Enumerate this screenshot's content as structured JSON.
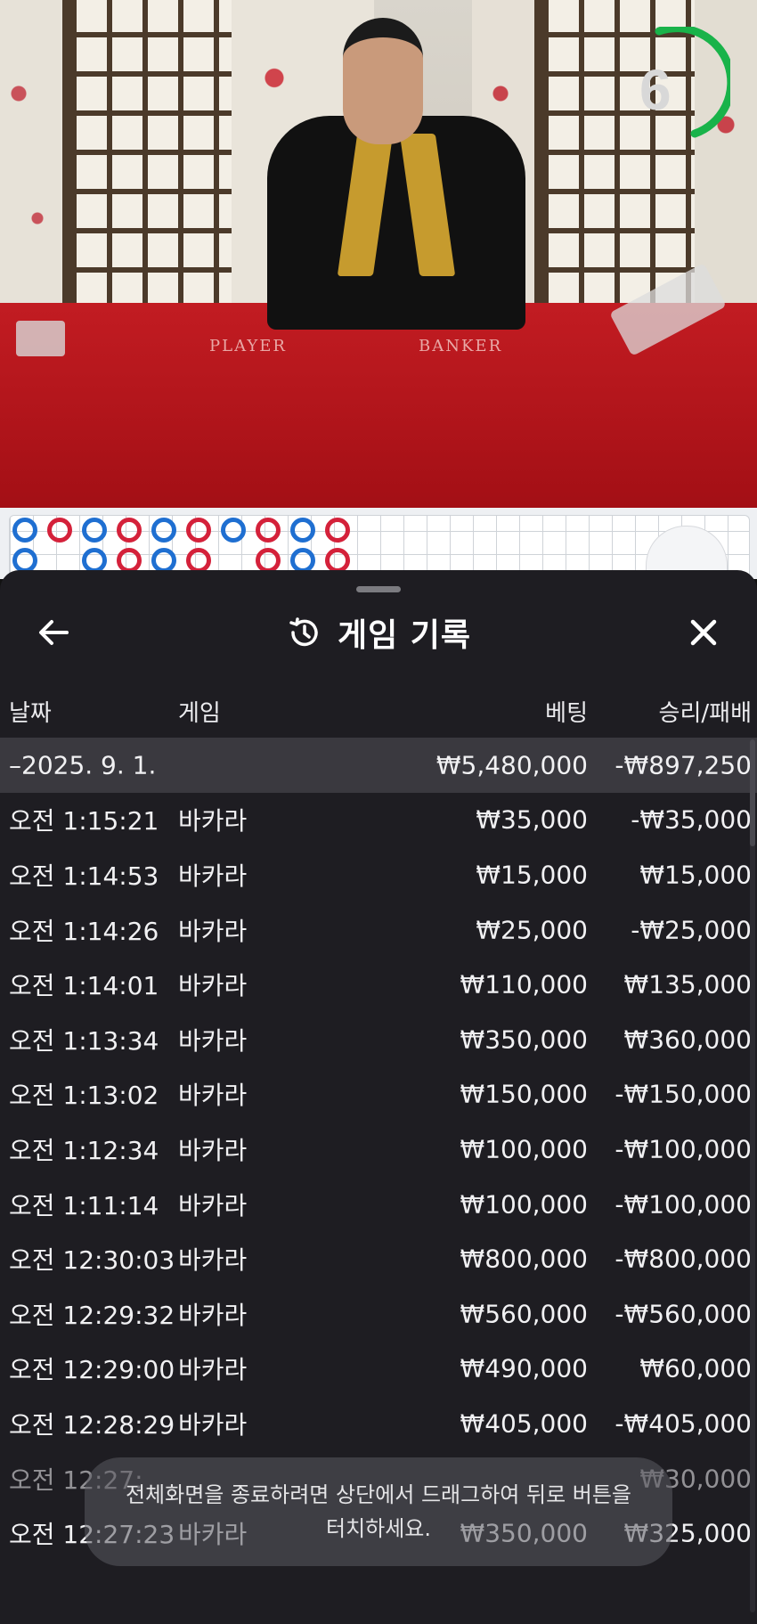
{
  "video": {
    "timer_value": "6",
    "timer_color": "#19b34a",
    "felt_labels": {
      "player": "PLAYER",
      "banker": "BANKER"
    }
  },
  "scoreboard": {
    "beads_top": [
      "blue",
      "red",
      "blue",
      "red",
      "blue",
      "red",
      "blue",
      "red",
      "blue",
      "red"
    ],
    "beads_bottom": [
      "blue",
      "",
      "blue",
      "red",
      "blue",
      "red",
      "",
      "red",
      "blue",
      "red"
    ],
    "expand_icon": "chevron-up-icon"
  },
  "history": {
    "title": "게임 기록",
    "title_icon": "history-icon",
    "back_icon": "arrow-left-icon",
    "close_icon": "close-icon",
    "columns": {
      "date": "날짜",
      "game": "게임",
      "bet": "베팅",
      "win_loss": "승리/패배"
    },
    "summary": {
      "date": "–2025. 9. 1.",
      "bet": "₩5,480,000",
      "win_loss": "-₩897,250"
    },
    "rows": [
      {
        "time": "오전 1:15:21",
        "game": "바카라",
        "bet": "₩35,000",
        "win_loss": "-₩35,000"
      },
      {
        "time": "오전 1:14:53",
        "game": "바카라",
        "bet": "₩15,000",
        "win_loss": "₩15,000"
      },
      {
        "time": "오전 1:14:26",
        "game": "바카라",
        "bet": "₩25,000",
        "win_loss": "-₩25,000"
      },
      {
        "time": "오전 1:14:01",
        "game": "바카라",
        "bet": "₩110,000",
        "win_loss": "₩135,000"
      },
      {
        "time": "오전 1:13:34",
        "game": "바카라",
        "bet": "₩350,000",
        "win_loss": "₩360,000"
      },
      {
        "time": "오전 1:13:02",
        "game": "바카라",
        "bet": "₩150,000",
        "win_loss": "-₩150,000"
      },
      {
        "time": "오전 1:12:34",
        "game": "바카라",
        "bet": "₩100,000",
        "win_loss": "-₩100,000"
      },
      {
        "time": "오전 1:11:14",
        "game": "바카라",
        "bet": "₩100,000",
        "win_loss": "-₩100,000"
      },
      {
        "time": "오전 12:30:03",
        "game": "바카라",
        "bet": "₩800,000",
        "win_loss": "-₩800,000"
      },
      {
        "time": "오전 12:29:32",
        "game": "바카라",
        "bet": "₩560,000",
        "win_loss": "-₩560,000"
      },
      {
        "time": "오전 12:29:00",
        "game": "바카라",
        "bet": "₩490,000",
        "win_loss": "₩60,000"
      },
      {
        "time": "오전 12:28:29",
        "game": "바카라",
        "bet": "₩405,000",
        "win_loss": "-₩405,000"
      },
      {
        "time": "오전 12:27:",
        "game": "",
        "bet": "",
        "win_loss": "₩30,000"
      },
      {
        "time": "오전 12:27:23",
        "game": "바카라",
        "bet": "₩350,000",
        "win_loss": "₩325,000"
      }
    ]
  },
  "toast": {
    "line1": "전체화면을 종료하려면 상단에서 드래그하여 뒤로 버튼을",
    "line2": "터치하세요."
  }
}
